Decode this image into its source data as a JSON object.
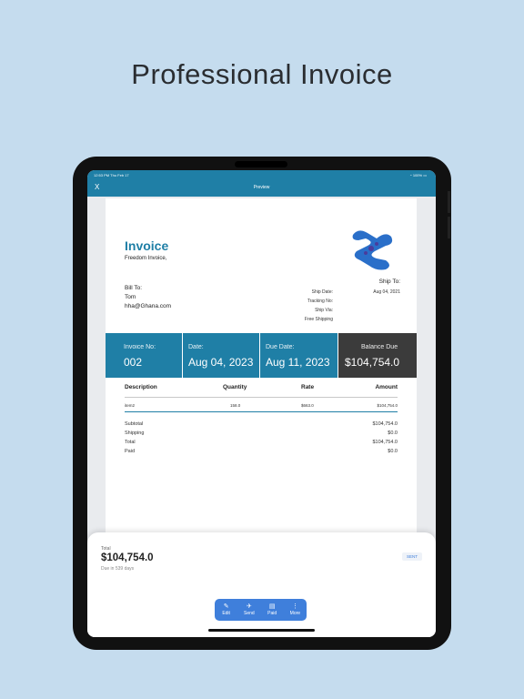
{
  "headline": "Professional Invoice",
  "status": {
    "time": "12:53 PM   Thu Feb 17",
    "battery": "100%"
  },
  "nav": {
    "close": "X",
    "title": "Preview"
  },
  "invoice": {
    "title": "Invoice",
    "company": "Freedom Invoice,",
    "ship_to_label": "Ship To:",
    "ship_to_date": "Aug 04, 2021",
    "bill_to_label": "Bill To:",
    "bill_name": "Tom",
    "bill_email": "hha@Ghana.com",
    "meta": [
      "Ship Date:",
      "Tracking No:",
      "Ship Via:",
      "Free Shipping"
    ],
    "band": {
      "invoice_no_label": "Invoice No:",
      "invoice_no": "002",
      "date_label": "Date:",
      "date": "Aug 04, 2023",
      "due_label": "Due Date:",
      "due": "Aug 11, 2023",
      "balance_label": "Balance Due",
      "balance": "$104,754.0"
    },
    "table": {
      "headers": [
        "Description",
        "Quantity",
        "Rate",
        "Amount"
      ],
      "row": [
        "item2",
        "158.0",
        "$663.0",
        "$104,754.0"
      ]
    },
    "totals": [
      {
        "label": "Subtotal",
        "value": "$104,754.0"
      },
      {
        "label": "Shipping",
        "value": "$0.0"
      },
      {
        "label": "Total",
        "value": "$104,754.0"
      },
      {
        "label": "Paid",
        "value": "$0.0"
      }
    ]
  },
  "sheet": {
    "total_label": "Total",
    "total": "$104,754.0",
    "due_text": "Due in 539 days",
    "badge": "SENT",
    "actions": [
      {
        "label": "Edit",
        "icon": "✎"
      },
      {
        "label": "Send",
        "icon": "✈"
      },
      {
        "label": "Paid",
        "icon": "▤"
      },
      {
        "label": "More",
        "icon": "⋮"
      }
    ]
  },
  "colors": {
    "accent": "#1f7fa6",
    "dark_cell": "#3b3b3b",
    "toolbar": "#3f7fdb",
    "background": "#c5dcee"
  }
}
